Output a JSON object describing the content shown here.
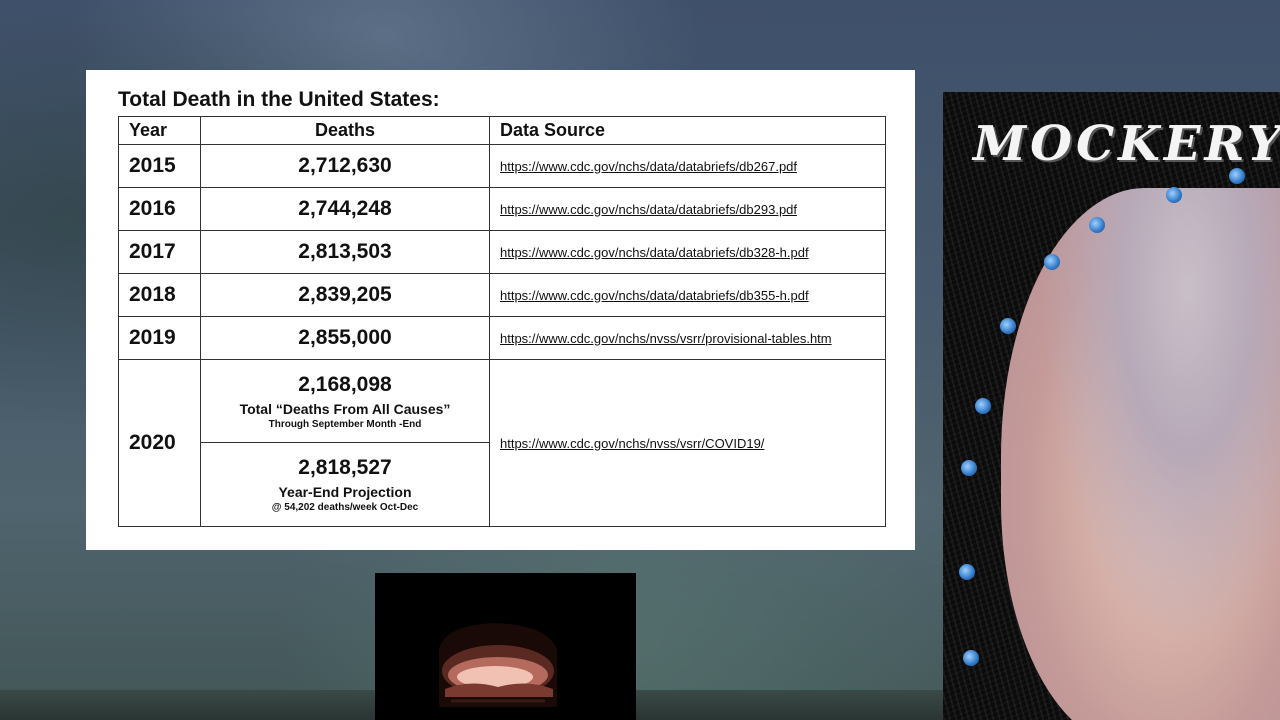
{
  "slide": {
    "title": "Total Death in the United States:",
    "headers": {
      "year": "Year",
      "deaths": "Deaths",
      "source": "Data Source"
    },
    "rows": [
      {
        "year": "2015",
        "deaths": "2,712,630",
        "source": "https://www.cdc.gov/nchs/data/databriefs/db267.pdf"
      },
      {
        "year": "2016",
        "deaths": "2,744,248",
        "source": "https://www.cdc.gov/nchs/data/databriefs/db293.pdf"
      },
      {
        "year": "2017",
        "deaths": "2,813,503",
        "source": "https://www.cdc.gov/nchs/data/databriefs/db328-h.pdf"
      },
      {
        "year": "2018",
        "deaths": "2,839,205",
        "source": "https://www.cdc.gov/nchs/data/databriefs/db355-h.pdf"
      },
      {
        "year": "2019",
        "deaths": "2,855,000",
        "source": "https://www.cdc.gov/nchs/nvss/vsrr/provisional-tables.htm"
      }
    ],
    "row_2020": {
      "year": "2020",
      "source": "https://www.cdc.gov/nchs/nvss/vsrr/COVID19/",
      "actual": {
        "value": "2,168,098",
        "label": "Total “Deaths From All Causes”",
        "note": "Through September Month -End"
      },
      "projection": {
        "value": "2,818,527",
        "label": "Year-End Projection",
        "note": "@ 54,202 deaths/week Oct-Dec"
      }
    }
  },
  "portrait": {
    "title": "MOCKERY",
    "dot_color": "#2f78c8"
  },
  "video": {
    "icon": "fireplace-icon"
  }
}
